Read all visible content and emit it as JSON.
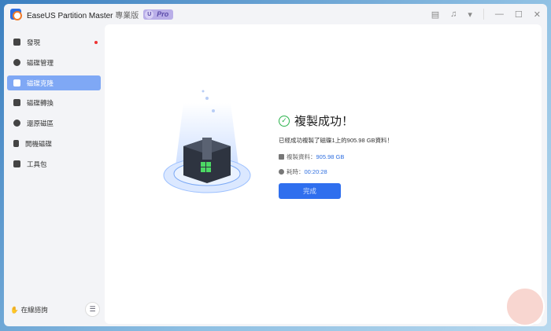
{
  "app": {
    "title": "EaseUS Partition Master",
    "edition": "專業版",
    "badge_letter": "U",
    "badge": "Pro"
  },
  "sidebar": {
    "items": [
      {
        "label": "發現"
      },
      {
        "label": "磁碟管理"
      },
      {
        "label": "磁碟克隆"
      },
      {
        "label": "磁碟轉換"
      },
      {
        "label": "還原磁區"
      },
      {
        "label": "開機磁碟"
      },
      {
        "label": "工具包"
      }
    ],
    "consult": "在線諮詢"
  },
  "result": {
    "title": "複製成功！",
    "message": "已經成功複製了磁碟1上的905.98 GB資料！",
    "copied_label": "複製資料：",
    "copied_value": "905.98 GB",
    "time_label": "耗時：",
    "time_value": "00:20:28",
    "done": "完成"
  },
  "colors": {
    "accent": "#2f6fee",
    "success": "#2bb24c"
  }
}
